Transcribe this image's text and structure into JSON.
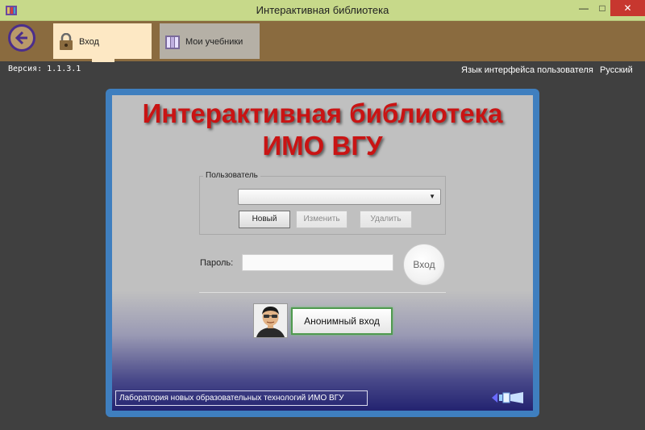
{
  "window": {
    "title": "Интерактивная библиотека",
    "minimize": "—",
    "maximize": "□",
    "close": "✕"
  },
  "toolbar": {
    "tabs": [
      {
        "label": "Вход",
        "icon": "lock-icon",
        "active": true
      },
      {
        "label": "Мои учебники",
        "icon": "books-icon",
        "active": false
      }
    ]
  },
  "version": "Версия: 1.1.3.1",
  "language": {
    "label": "Язык интерфейса пользователя",
    "value": "Русский"
  },
  "main": {
    "heading_line1": "Интерактивная библиотека",
    "heading_line2": "ИМО ВГУ",
    "user_group_label": "Пользователь",
    "user_select_value": "",
    "buttons": {
      "new": "Новый",
      "edit": "Изменить",
      "delete": "Удалить"
    },
    "password_label": "Пароль:",
    "password_value": "",
    "login_button": "Вход",
    "anonymous_button": "Анонимный вход"
  },
  "footer": {
    "lab_label": "Лаборатория новых образовательных технологий ИМО ВГУ"
  },
  "colors": {
    "title_bar": "#c7d98a",
    "toolbar": "#8a6b3f",
    "active_tab": "#fde8c4",
    "heading": "#c91414",
    "panel_border": "#3f7fbf"
  }
}
